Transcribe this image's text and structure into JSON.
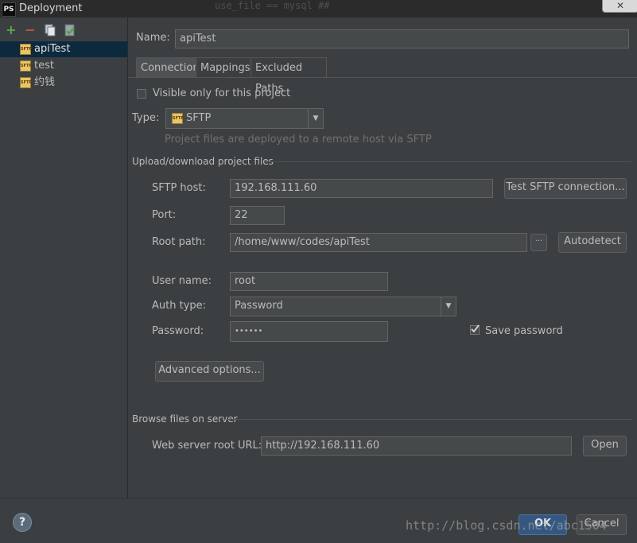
{
  "window": {
    "title": "Deployment",
    "app_icon": "PS",
    "bg_code": "use_file        ==    mysql    ##",
    "close": "✕"
  },
  "toolbar": {
    "add_icon": "+",
    "remove_icon": "−",
    "copy_icon": "copy-icon",
    "default_icon": "check-default-icon"
  },
  "servers": [
    {
      "name": "apiTest",
      "selected": true
    },
    {
      "name": "test",
      "selected": false
    },
    {
      "name": "约钱",
      "selected": false
    }
  ],
  "icon_text": "SFTP",
  "name_label": "Name:",
  "name_value": "apiTest",
  "tabs": [
    {
      "label": "Connection",
      "active": true
    },
    {
      "label": "Mappings",
      "active": false
    },
    {
      "label": "Excluded Paths",
      "active": false
    }
  ],
  "connection": {
    "visible_only_label": "Visible only for this project",
    "type_label": "Type:",
    "type_value": "SFTP",
    "type_hint": "Project files are deployed to a remote host via SFTP",
    "upload_section": "Upload/download project files",
    "host_label": "SFTP host:",
    "host_value": "192.168.111.60",
    "test_button": "Test SFTP connection...",
    "port_label": "Port:",
    "port_value": "22",
    "root_label": "Root path:",
    "root_value": "/home/www/codes/apiTest",
    "browse_button": "···",
    "autodetect_button": "Autodetect",
    "user_label": "User name:",
    "user_value": "root",
    "auth_label": "Auth type:",
    "auth_value": "Password",
    "password_label": "Password:",
    "password_value": "••••••",
    "save_password_label": "Save password",
    "advanced_button": "Advanced options...",
    "browse_section": "Browse files on server",
    "web_label": "Web server root URL:",
    "web_value": "http://192.168.111.60",
    "open_button": "Open"
  },
  "footer": {
    "help": "?",
    "ok": "OK",
    "cancel": "Cancel",
    "watermark": "http://blog.csdn.net/abc1504"
  }
}
